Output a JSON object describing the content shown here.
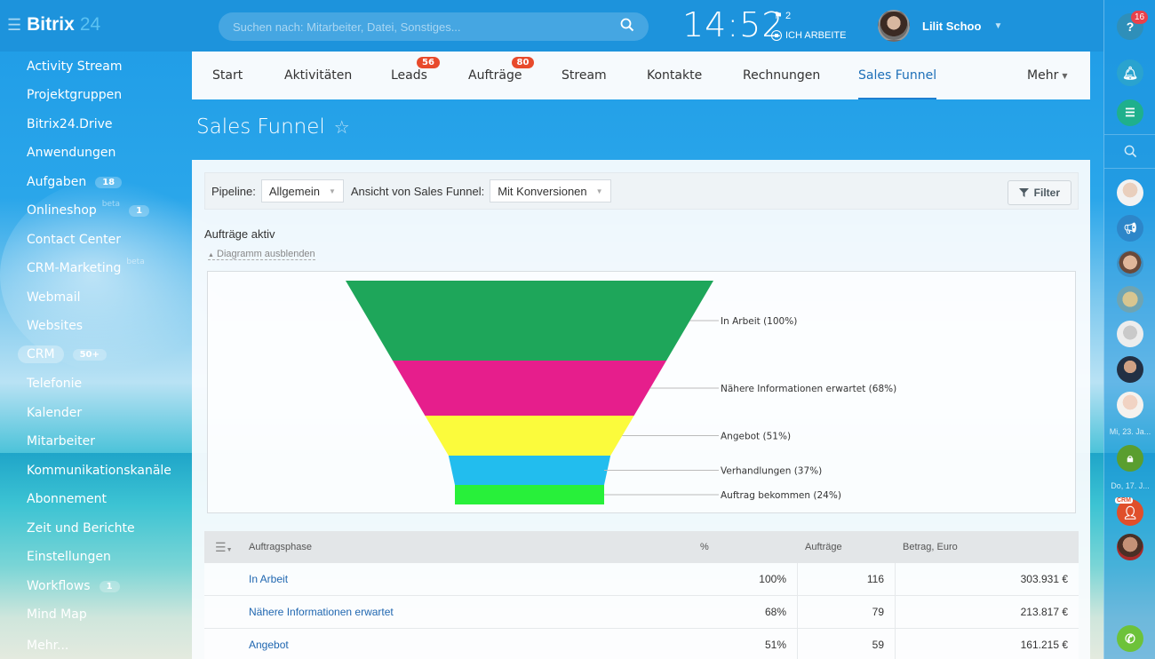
{
  "header": {
    "logo_text": "Bitrix",
    "logo_number": "24",
    "search_placeholder": "Suchen nach: Mitarbeiter, Datei, Sonstiges...",
    "clock": "14:52",
    "flag_count": "2",
    "work_status": "ICH ARBEITE",
    "user_name": "Lilit Schoo"
  },
  "sidebar": {
    "items": [
      {
        "label": "Activity Stream"
      },
      {
        "label": "Projektgruppen"
      },
      {
        "label": "Bitrix24.Drive"
      },
      {
        "label": "Anwendungen"
      },
      {
        "label": "Aufgaben",
        "counter": "18"
      },
      {
        "label": "Onlineshop",
        "beta": "beta",
        "counter": "1"
      },
      {
        "label": "Contact Center"
      },
      {
        "label": "CRM-Marketing",
        "beta": "beta"
      },
      {
        "label": "Webmail"
      },
      {
        "label": "Websites"
      },
      {
        "label": "CRM",
        "counter": "50+",
        "active": true
      },
      {
        "label": "Telefonie"
      },
      {
        "label": "Kalender"
      },
      {
        "label": "Mitarbeiter"
      },
      {
        "label": "Kommunikationskanäle"
      },
      {
        "label": "Abonnement"
      },
      {
        "label": "Zeit und Berichte"
      },
      {
        "label": "Einstellungen"
      },
      {
        "label": "Workflows",
        "counter": "1"
      },
      {
        "label": "Mind Map"
      },
      {
        "label": "Mehr..."
      }
    ]
  },
  "rightbar": {
    "help_label": "?",
    "help_badge": "16",
    "date1": "Mi, 23. Ja...",
    "date2": "Do, 17. J...",
    "crm_label": "CRM"
  },
  "tabs": [
    {
      "label": "Start"
    },
    {
      "label": "Aktivitäten"
    },
    {
      "label": "Leads",
      "badge": "56"
    },
    {
      "label": "Aufträge",
      "badge": "80"
    },
    {
      "label": "Stream"
    },
    {
      "label": "Kontakte"
    },
    {
      "label": "Rechnungen"
    },
    {
      "label": "Sales Funnel",
      "active": true
    },
    {
      "label": "Mehr"
    }
  ],
  "page": {
    "title": "Sales Funnel",
    "star": "☆"
  },
  "filters": {
    "pipeline_label": "Pipeline:",
    "pipeline_value": "Allgemein",
    "view_label": "Ansicht von Sales Funnel:",
    "view_value": "Mit Konversionen",
    "filter_button": "Filter"
  },
  "section": {
    "title": "Aufträge aktiv",
    "toggle": "Diagramm ausblenden"
  },
  "chart_data": {
    "type": "funnel",
    "title": "",
    "stages": [
      {
        "label": "In Arbeit (100%)",
        "name": "In Arbeit",
        "percent": 100,
        "color": "#1ea65a"
      },
      {
        "label": "Nähere Informationen erwartet (68%)",
        "name": "Nähere Informationen erwartet",
        "percent": 68,
        "color": "#e61e8c"
      },
      {
        "label": "Angebot (51%)",
        "name": "Angebot",
        "percent": 51,
        "color": "#fbfb3c"
      },
      {
        "label": "Verhandlungen (37%)",
        "name": "Verhandlungen",
        "percent": 37,
        "color": "#22bdee"
      },
      {
        "label": "Auftrag bekommen (24%)",
        "name": "Auftrag bekommen",
        "percent": 24,
        "color": "#28f03a"
      }
    ]
  },
  "table": {
    "headers": [
      "Auftragsphase",
      "%",
      "Aufträge",
      "Betrag, Euro"
    ],
    "rows": [
      {
        "phase": "In Arbeit",
        "percent": "100%",
        "count": "116",
        "amount": "303.931 €"
      },
      {
        "phase": "Nähere Informationen erwartet",
        "percent": "68%",
        "count": "79",
        "amount": "213.817 €"
      },
      {
        "phase": "Angebot",
        "percent": "51%",
        "count": "59",
        "amount": "161.215 €"
      }
    ]
  }
}
